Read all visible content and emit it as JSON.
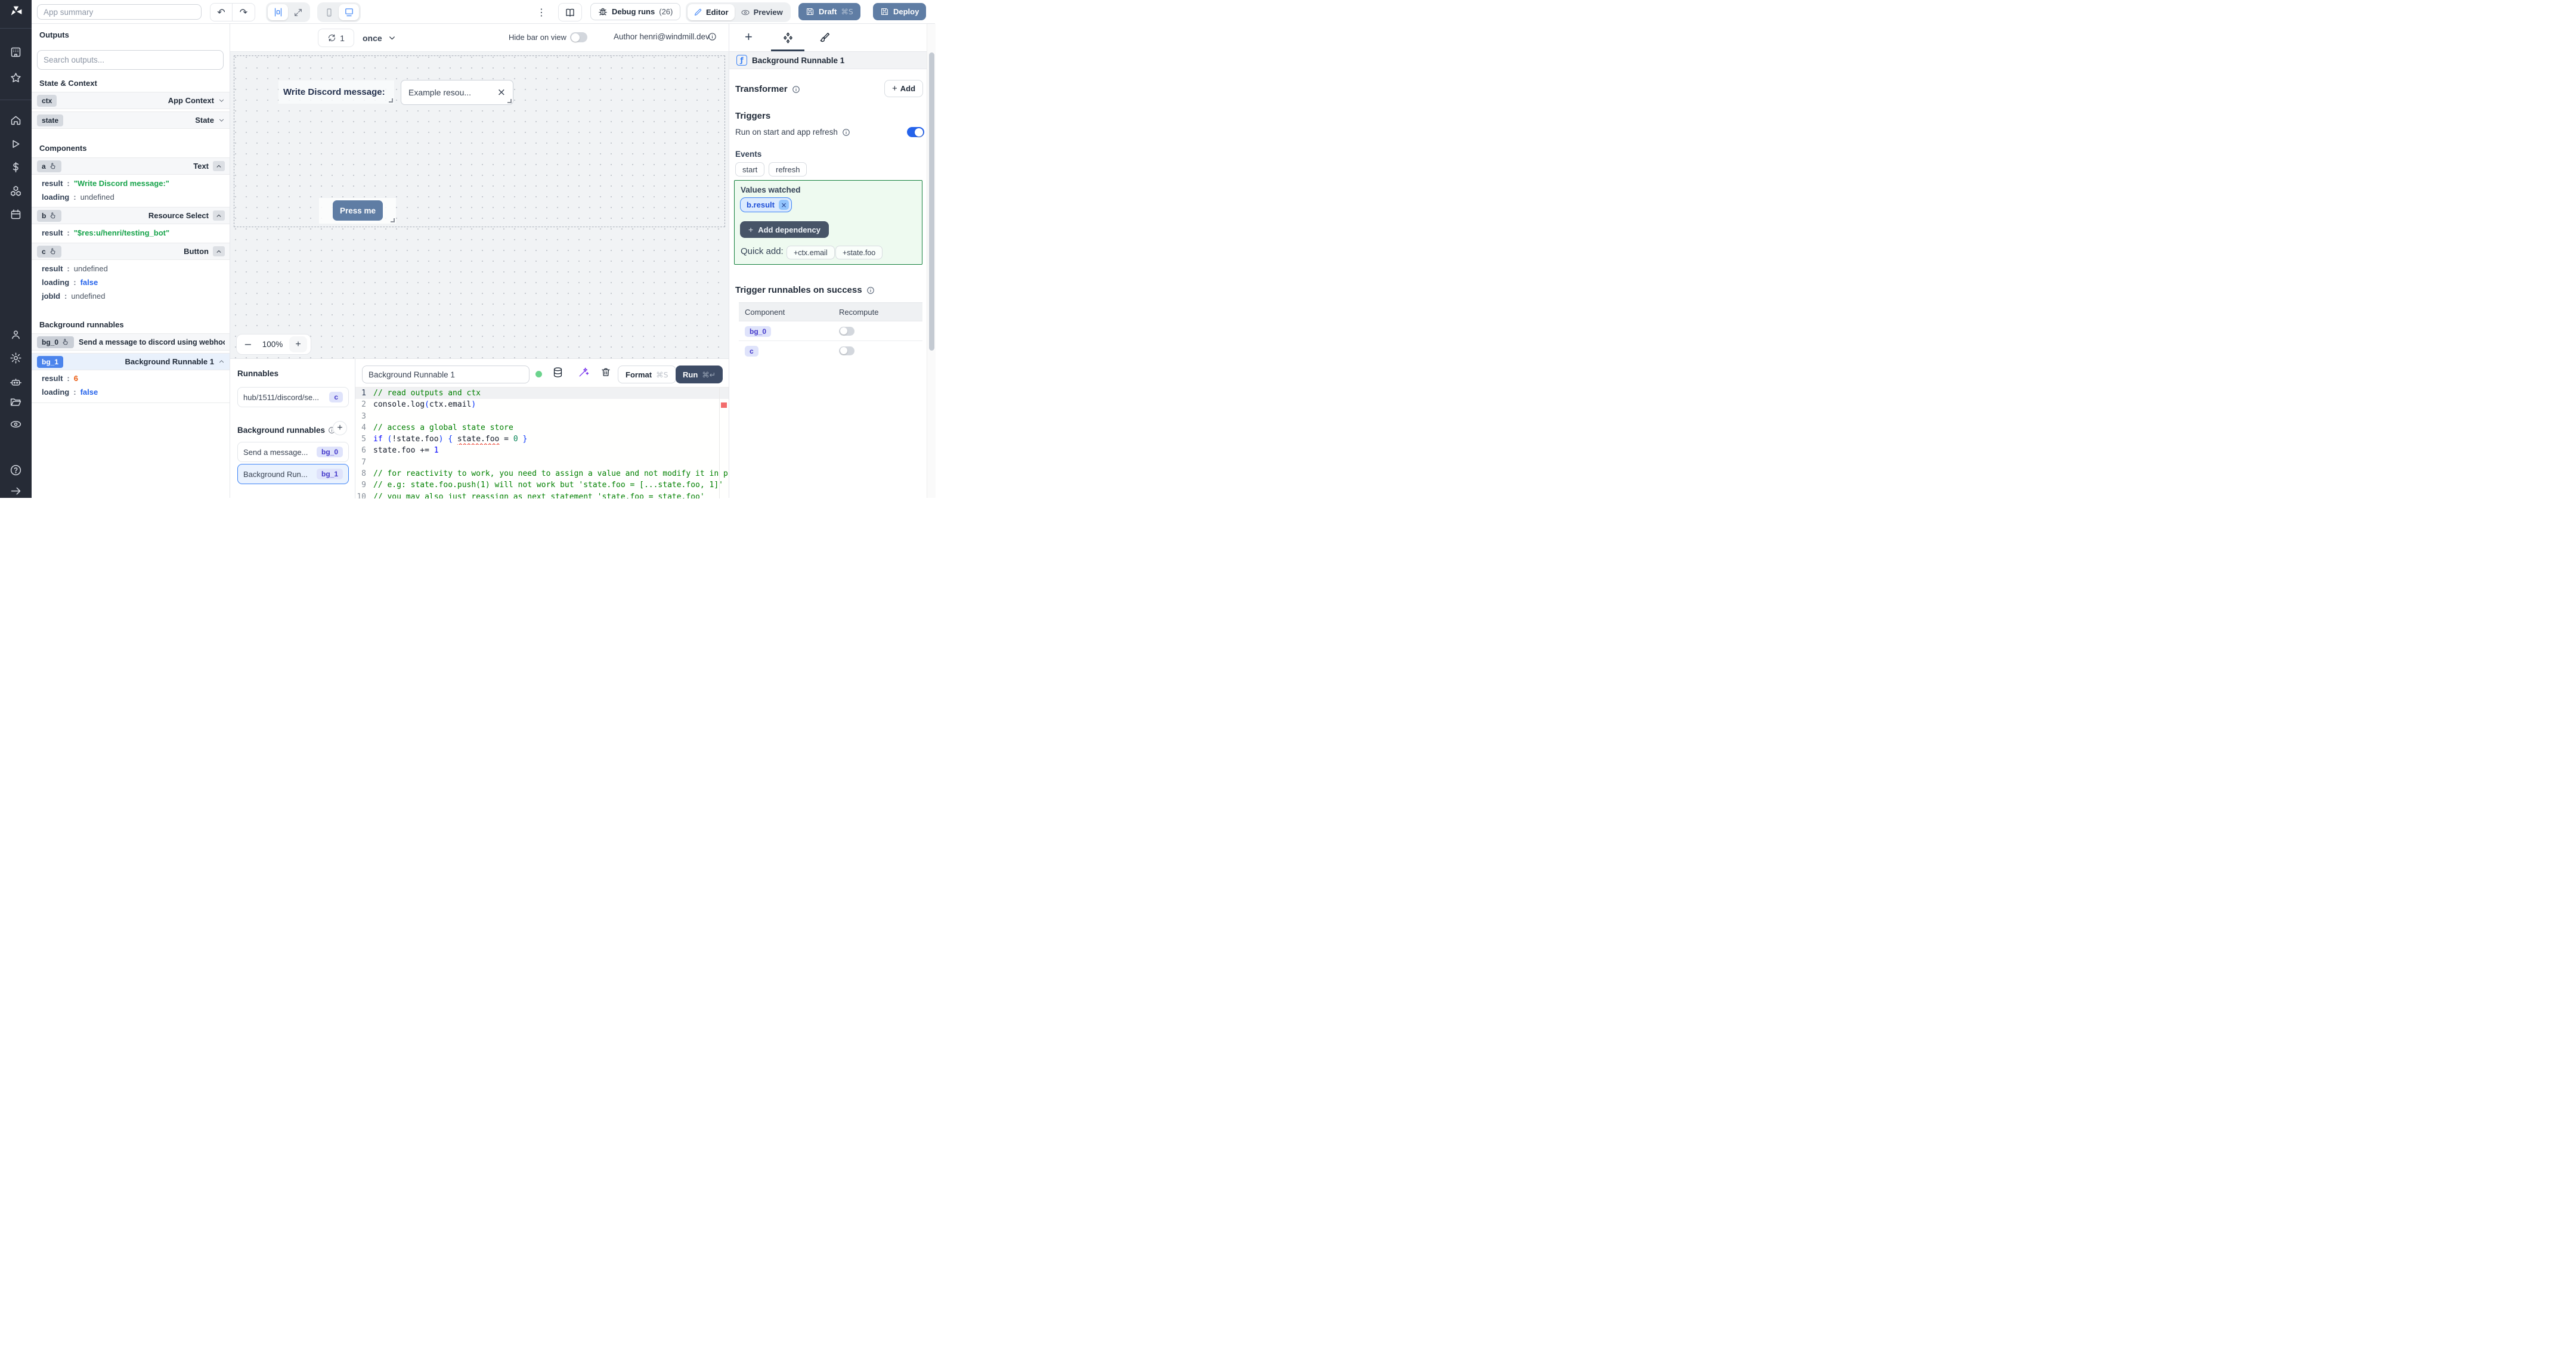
{
  "colors": {
    "accent_blue": "#3b82f6",
    "slate_button": "#5f7da4",
    "run_button": "#3e4c66",
    "green_value": "#16a34a",
    "orange_value": "#ea580c",
    "blue_value": "#2563eb",
    "green_box_border": "#15803d",
    "indigo_badge": "#4338ca",
    "rail_bg": "#262b36"
  },
  "icons": {
    "kebab": "⋮",
    "undo": "↶",
    "redo": "↷",
    "close": "×",
    "plus": "+",
    "minus": "−",
    "dollar": "$",
    "fx": "ƒ",
    "help": "?",
    "arrow_right": "→",
    "caret_up": "⌃"
  },
  "topbar": {
    "app_summary_placeholder": "App summary",
    "debug_label": "Debug runs",
    "debug_count": "(26)",
    "editor": "Editor",
    "preview": "Preview",
    "draft": "Draft",
    "draft_kbd": "⌘S",
    "deploy": "Deploy"
  },
  "outputs": {
    "title": "Outputs",
    "search_placeholder": "Search outputs...",
    "state_context_title": "State & Context",
    "ctx": {
      "id": "ctx",
      "label": "App Context"
    },
    "state": {
      "id": "state",
      "label": "State"
    },
    "components_title": "Components",
    "a": {
      "id": "a",
      "type": "Text",
      "p0": {
        "k": "result",
        "v": "\"Write Discord message:\""
      },
      "p1": {
        "k": "loading",
        "v": "undefined"
      }
    },
    "b": {
      "id": "b",
      "type": "Resource Select",
      "p0": {
        "k": "result",
        "v": "\"$res:u/henri/testing_bot\""
      }
    },
    "c": {
      "id": "c",
      "type": "Button",
      "p0": {
        "k": "result",
        "v": "undefined"
      },
      "p1": {
        "k": "loading",
        "v": "false"
      },
      "p2": {
        "k": "jobId",
        "v": "undefined"
      }
    },
    "background_title": "Background runnables",
    "bg0": {
      "id": "bg_0",
      "label": "Send a message to discord using webhoo"
    },
    "bg1": {
      "id": "bg_1",
      "label": "Background Runnable 1",
      "p0": {
        "k": "result",
        "v": "6"
      },
      "p1": {
        "k": "loading",
        "v": "false"
      }
    }
  },
  "canvasbar": {
    "refresh_count": "1",
    "mode": "once",
    "hide_bar_label": "Hide bar on view",
    "author": "Author henri@windmill.dev"
  },
  "canvas": {
    "text_component": "Write Discord message:",
    "select_value": "Example resou...",
    "button_label": "Press me",
    "zoom": {
      "minus": "−",
      "level": "100%",
      "plus": "+"
    }
  },
  "runnables": {
    "title": "Runnables",
    "main_item": {
      "label": "hub/1511/discord/se...",
      "badge": "c"
    },
    "bg_title": "Background runnables",
    "item0": {
      "label": "Send a message...",
      "badge": "bg_0"
    },
    "item1": {
      "label": "Background Run...",
      "badge": "bg_1"
    }
  },
  "editor": {
    "name": "Background Runnable 1",
    "format": "Format",
    "format_kbd": "⌘S",
    "run": "Run",
    "run_kbd": "⌘↵",
    "code": {
      "lines": [
        {
          "n": "1",
          "active": true,
          "tokens": [
            {
              "t": "// read outputs and ctx",
              "c": "cmt"
            }
          ]
        },
        {
          "n": "2",
          "tokens": [
            {
              "t": "console.log",
              "c": "pln"
            },
            {
              "t": "(",
              "c": "pn"
            },
            {
              "t": "ctx.email",
              "c": "pln"
            },
            {
              "t": ")",
              "c": "pn"
            }
          ]
        },
        {
          "n": "3",
          "tokens": []
        },
        {
          "n": "4",
          "tokens": [
            {
              "t": "// access a global state store",
              "c": "cmt"
            }
          ]
        },
        {
          "n": "5",
          "tokens": [
            {
              "t": "if",
              "c": "kw"
            },
            {
              "t": " ",
              "c": "pln"
            },
            {
              "t": "(",
              "c": "pn"
            },
            {
              "t": "!state.foo",
              "c": "pln"
            },
            {
              "t": ")",
              "c": "pn"
            },
            {
              "t": " ",
              "c": "pln"
            },
            {
              "t": "{",
              "c": "pn"
            },
            {
              "t": " ",
              "c": "pln"
            },
            {
              "t": "state.foo",
              "c": "sqg"
            },
            {
              "t": " = ",
              "c": "pln"
            },
            {
              "t": "0",
              "c": "num"
            },
            {
              "t": " ",
              "c": "pln"
            },
            {
              "t": "}",
              "c": "pn"
            }
          ]
        },
        {
          "n": "6",
          "tokens": [
            {
              "t": "state.foo += ",
              "c": "pln"
            },
            {
              "t": "1",
              "c": "kw"
            }
          ]
        },
        {
          "n": "7",
          "tokens": []
        },
        {
          "n": "8",
          "tokens": [
            {
              "t": "// for reactivity to work, you need to assign a value and not modify it in p",
              "c": "cmt"
            }
          ]
        },
        {
          "n": "9",
          "tokens": [
            {
              "t": "// e.g: state.foo.push(1) will not work but 'state.foo = [...state.foo, 1]'",
              "c": "cmt"
            }
          ]
        },
        {
          "n": "10",
          "tokens": [
            {
              "t": "// you may also just reassign as next statement 'state.foo = state.foo'",
              "c": "cmt"
            }
          ]
        }
      ]
    }
  },
  "inspector": {
    "header": "Background Runnable 1",
    "transformer": "Transformer",
    "add": "Add",
    "triggers": "Triggers",
    "run_on_start": "Run on start and app refresh",
    "events": "Events",
    "event_chips": [
      "start",
      "refresh"
    ],
    "vw_title": "Values watched",
    "vw_chip": "b.result",
    "add_dep": "Add dependency",
    "quick": "Quick add:",
    "quick_chips": [
      "+ctx.email",
      "+state.foo"
    ],
    "tros_title": "Trigger runnables on success",
    "col_component": "Component",
    "col_recompute": "Recompute",
    "row0_id": "bg_0",
    "row1_id": "c"
  }
}
